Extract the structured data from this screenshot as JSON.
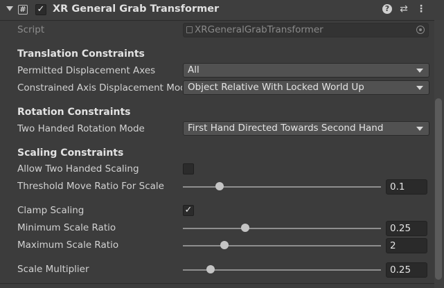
{
  "component": {
    "title": "XR General Grab Transformer",
    "enabled": true,
    "icon": "script-icon",
    "header_icons": [
      "help-icon",
      "preset-icon",
      "kebab-menu-icon"
    ]
  },
  "script_field": {
    "label": "Script",
    "value": "XRGeneralGrabTransformer"
  },
  "translation": {
    "header": "Translation Constraints",
    "permitted_axes": {
      "label": "Permitted Displacement Axes",
      "value": "All"
    },
    "constrained_mode": {
      "label": "Constrained Axis Displacement Mode",
      "value": "Object Relative With Locked World Up"
    }
  },
  "rotation": {
    "header": "Rotation Constraints",
    "two_handed_mode": {
      "label": "Two Handed Rotation Mode",
      "value": "First Hand Directed Towards Second Hand"
    }
  },
  "scaling": {
    "header": "Scaling Constraints",
    "allow_two_handed": {
      "label": "Allow Two Handed Scaling",
      "checked": false
    },
    "threshold_move": {
      "label": "Threshold Move Ratio For Scale",
      "value": "0.1",
      "fraction": 0.1
    },
    "clamp": {
      "label": "Clamp Scaling",
      "checked": true
    },
    "min_ratio": {
      "label": "Minimum Scale Ratio",
      "value": "0.25",
      "fraction": 0.25
    },
    "max_ratio": {
      "label": "Maximum Scale Ratio",
      "value": "2",
      "fraction": 0.13
    },
    "multiplier": {
      "label": "Scale Multiplier",
      "value": "0.25",
      "fraction": 0.05
    }
  },
  "colors": {
    "background": "#3c3c3c",
    "field": "#515151",
    "number_field": "#2a2a2a",
    "slider_thumb": "#c4c4c4"
  }
}
